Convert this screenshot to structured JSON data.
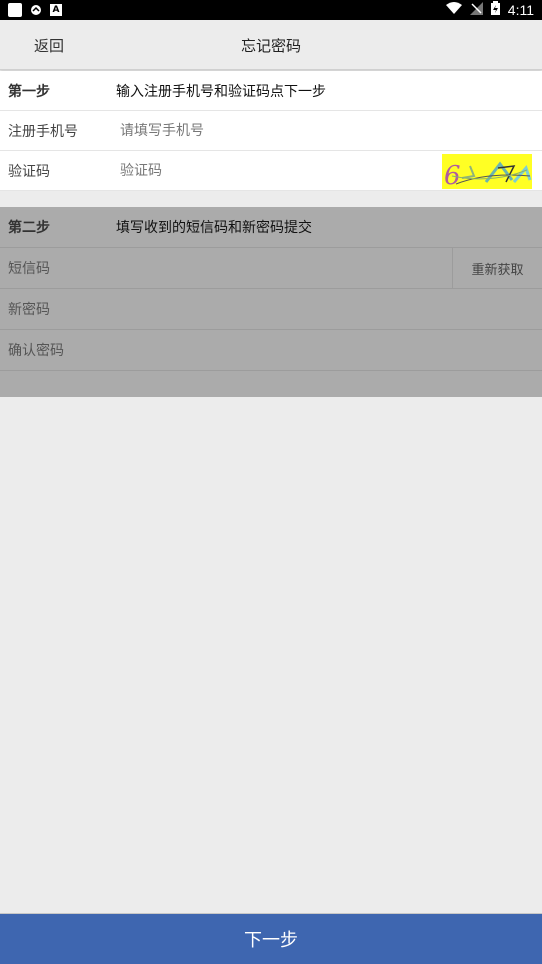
{
  "status_bar": {
    "time": "4:11",
    "icons": [
      "app-icon",
      "notification-icon",
      "a-icon",
      "wifi-icon",
      "signal-icon",
      "battery-icon"
    ]
  },
  "header": {
    "back_label": "返回",
    "title": "忘记密码"
  },
  "step1": {
    "step_label": "第一步",
    "description": "输入注册手机号和验证码点下一步",
    "phone_label": "注册手机号",
    "phone_placeholder": "请填写手机号",
    "code_label": "验证码",
    "code_placeholder": "验证码",
    "captcha_text": "6"
  },
  "step2": {
    "step_label": "第二步",
    "description": "填写收到的短信码和新密码提交",
    "sms_label": "短信码",
    "resend_label": "重新获取",
    "new_password_label": "新密码",
    "confirm_password_label": "确认密码"
  },
  "footer": {
    "next_label": "下一步"
  },
  "colors": {
    "primary": "#3e66b0",
    "disabled_section": "#ababab",
    "captcha_bg": "#ffff24"
  }
}
